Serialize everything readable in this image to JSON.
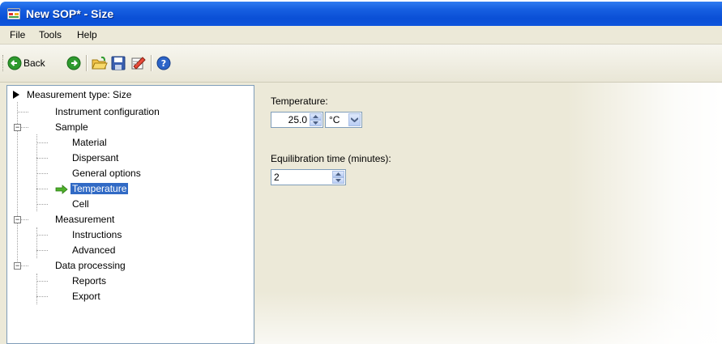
{
  "window": {
    "title": "New SOP* - Size"
  },
  "menu": [
    "File",
    "Tools",
    "Help"
  ],
  "toolbar": {
    "back_label": "Back"
  },
  "tree": {
    "root": "Measurement type: Size",
    "items": {
      "instrument": "Instrument configuration",
      "sample": "Sample",
      "material": "Material",
      "dispersant": "Dispersant",
      "general": "General options",
      "temperature": "Temperature",
      "cell": "Cell",
      "measurement": "Measurement",
      "instructions": "Instructions",
      "advanced": "Advanced",
      "data_processing": "Data processing",
      "reports": "Reports",
      "export": "Export"
    },
    "selected": "Temperature"
  },
  "form": {
    "temperature_label": "Temperature:",
    "temperature_value": "25.0",
    "temperature_unit": "°C",
    "equilibration_label": "Equilibration  time (minutes):",
    "equilibration_value": "2"
  },
  "colors": {
    "titlebar": "#0a4fd6",
    "selection": "#316ac5",
    "panel": "#ece9d8"
  }
}
